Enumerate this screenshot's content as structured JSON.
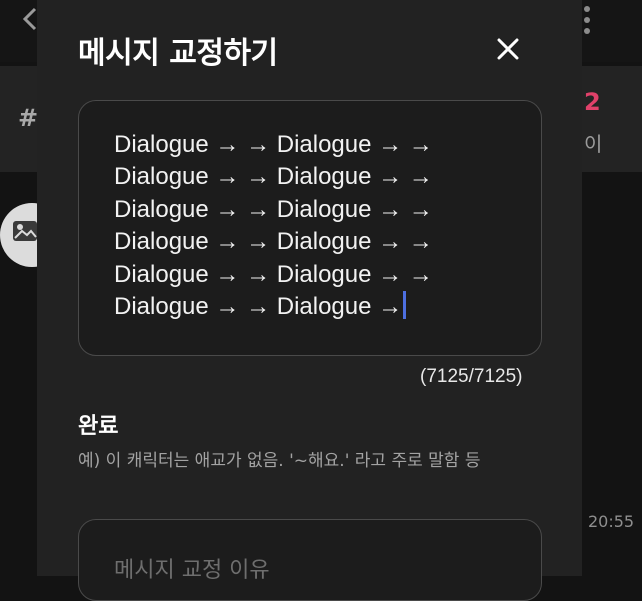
{
  "background": {
    "back_icon": "chevron-left-icon",
    "menu_icon": "kebab-menu-icon",
    "hash": "#",
    "count": "2",
    "side_text": "이",
    "avatar_icon": "image-icon",
    "time": "20:55",
    "accent": "#e0416a"
  },
  "modal": {
    "title": "메시지 교정하기",
    "close_icon": "close-icon",
    "message_lines": [
      "Dialogue → → Dialogue → →",
      "Dialogue → → Dialogue → →",
      "Dialogue → → Dialogue → →",
      "Dialogue → → Dialogue → →",
      "Dialogue → → Dialogue → →",
      "Dialogue → → Dialogue →"
    ],
    "char_count": "(7125/7125)",
    "section_title": "완료",
    "hint": "예) 이 캐릭터는 애교가 없음. '~해요.' 라고 주로 말함 등",
    "reason_placeholder": "메시지 교정 이유",
    "caret_color": "#4d6fe0"
  }
}
